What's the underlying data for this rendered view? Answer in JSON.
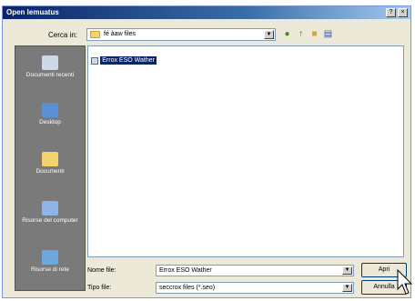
{
  "window": {
    "title": "Open lemuatus"
  },
  "lookin": {
    "label": "Cerca in:",
    "value": "fé àaw files"
  },
  "places": [
    {
      "label": "Documenti recenti",
      "icon": "recent-documents-icon",
      "color": "#cfd8e8"
    },
    {
      "label": "Desktop",
      "icon": "desktop-icon",
      "color": "#5b8fd6"
    },
    {
      "label": "Documenti",
      "icon": "my-documents-icon",
      "color": "#f3d36b"
    },
    {
      "label": "Risorse del computer",
      "icon": "my-computer-icon",
      "color": "#8fb3e6"
    },
    {
      "label": "Risorse di rete",
      "icon": "network-places-icon",
      "color": "#6fa8dc"
    }
  ],
  "files": [
    {
      "name": "Errox ESO Wather"
    }
  ],
  "filename": {
    "label": "Nome file:",
    "value": "Errox ESO Wather"
  },
  "filetype": {
    "label": "Tipo file:",
    "value": "seccrox files (*.seo)"
  },
  "buttons": {
    "open": "Apri",
    "cancel": "Annulla"
  },
  "colors": {
    "selection": "#0a246a",
    "titlebar": "#0a246a",
    "places_bar": "#7a7a7a"
  }
}
